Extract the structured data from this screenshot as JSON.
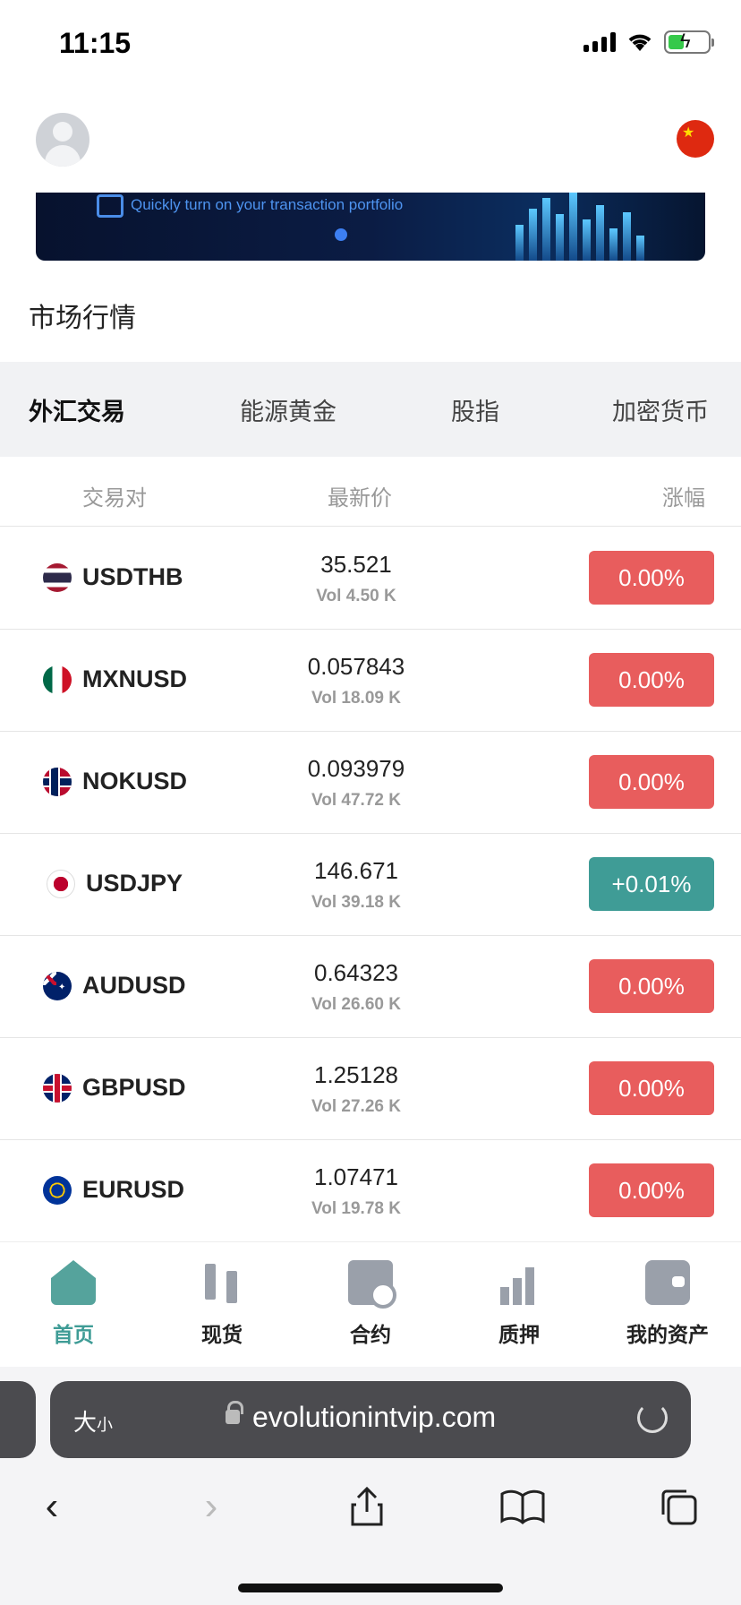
{
  "status_bar": {
    "time": "11:15"
  },
  "banner": {
    "text": "Quickly turn on your transaction portfolio"
  },
  "section_title": "市场行情",
  "tabs": [
    {
      "label": "外汇交易",
      "active": true
    },
    {
      "label": "能源黄金",
      "active": false
    },
    {
      "label": "股指",
      "active": false
    },
    {
      "label": "加密货币",
      "active": false
    }
  ],
  "table": {
    "headers": {
      "pair": "交易对",
      "price": "最新价",
      "change": "涨幅"
    },
    "rows": [
      {
        "pair": "USDTHB",
        "flag": "thailand-flag",
        "price": "35.521",
        "vol": "Vol 4.50 K",
        "change": "0.00%",
        "direction": "down"
      },
      {
        "pair": "MXNUSD",
        "flag": "mexico-flag",
        "price": "0.057843",
        "vol": "Vol 18.09 K",
        "change": "0.00%",
        "direction": "down"
      },
      {
        "pair": "NOKUSD",
        "flag": "norway-flag",
        "price": "0.093979",
        "vol": "Vol 47.72 K",
        "change": "0.00%",
        "direction": "down"
      },
      {
        "pair": "USDJPY",
        "flag": "japan-flag",
        "price": "146.671",
        "vol": "Vol 39.18 K",
        "change": "+0.01%",
        "direction": "up"
      },
      {
        "pair": "AUDUSD",
        "flag": "australia-flag",
        "price": "0.64323",
        "vol": "Vol 26.60 K",
        "change": "0.00%",
        "direction": "down"
      },
      {
        "pair": "GBPUSD",
        "flag": "uk-flag",
        "price": "1.25128",
        "vol": "Vol 27.26 K",
        "change": "0.00%",
        "direction": "down"
      },
      {
        "pair": "EURUSD",
        "flag": "eu-flag",
        "price": "1.07471",
        "vol": "Vol 19.78 K",
        "change": "0.00%",
        "direction": "down"
      }
    ]
  },
  "bottom_nav": [
    {
      "label": "首页",
      "icon": "home-icon",
      "active": true
    },
    {
      "label": "现货",
      "icon": "candlestick-icon",
      "active": false
    },
    {
      "label": "合约",
      "icon": "contract-icon",
      "active": false
    },
    {
      "label": "质押",
      "icon": "chart-growth-icon",
      "active": false
    },
    {
      "label": "我的资产",
      "icon": "wallet-icon",
      "active": false
    }
  ],
  "browser": {
    "text_size_label": "大",
    "text_size_small": "小",
    "url": "evolutionintvip.com"
  },
  "colors": {
    "down": "#e85d5d",
    "up": "#3f9c96",
    "accent": "#3f9c96"
  }
}
